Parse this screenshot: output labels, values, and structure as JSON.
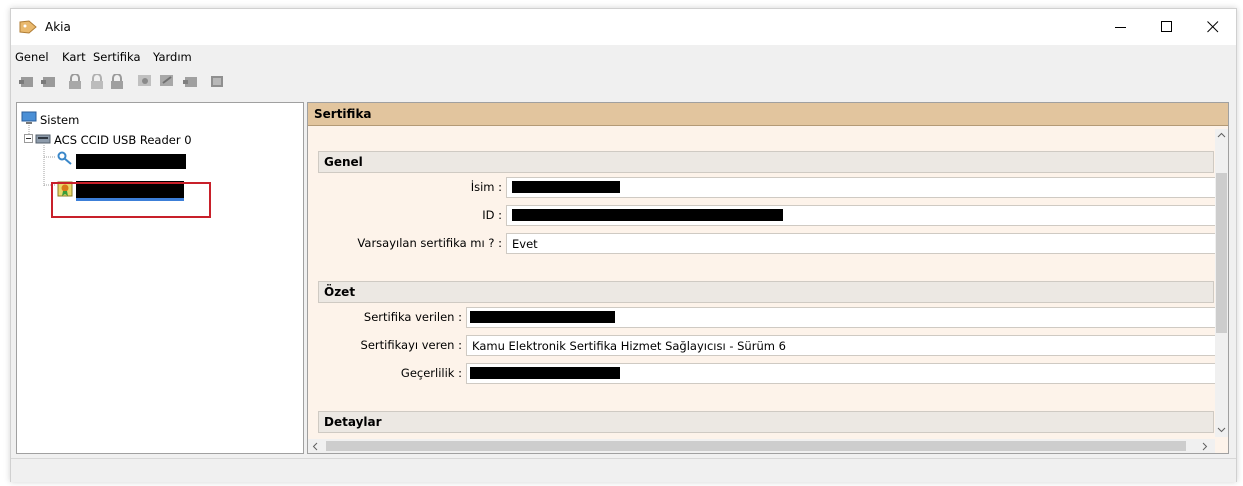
{
  "window": {
    "title": "Akia"
  },
  "menu": [
    "Genel",
    "Kart",
    "Sertifika",
    "Yardım"
  ],
  "toolbar_icons": [
    "card-icon",
    "card-icon",
    "lock-icon",
    "lock-icon",
    "lock-icon",
    "certificate-icon",
    "certificate-icon",
    "card-icon",
    "card-icon"
  ],
  "tree": {
    "root": "Sistem",
    "reader": "ACS CCID USB Reader 0"
  },
  "panel": {
    "title": "Sertifika",
    "genel": {
      "header": "Genel",
      "isim_label": "İsim :",
      "id_label": "ID :",
      "default_label": "Varsayılan sertifika mı ? :",
      "default_value": "Evet"
    },
    "ozet": {
      "header": "Özet",
      "verilen_label": "Sertifika verilen :",
      "veren_label": "Sertifikayı veren :",
      "veren_value": "Kamu Elektronik Sertifika Hizmet Sağlayıcısı - Sürüm 6",
      "gecerlilik_label": "Geçerlilik :"
    },
    "detaylar": {
      "header": "Detaylar"
    }
  }
}
